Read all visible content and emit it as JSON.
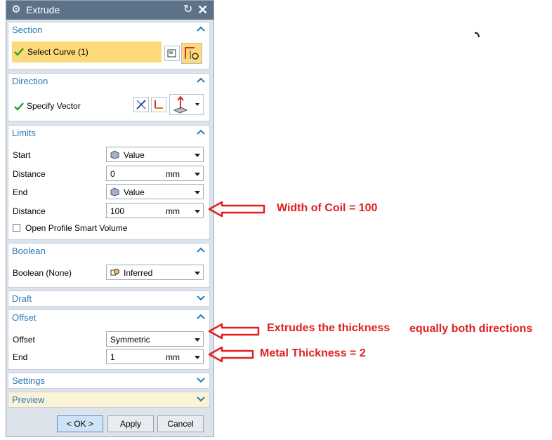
{
  "dialog": {
    "title": "Extrude",
    "reset_icon": "reset-icon",
    "close_icon": "close-icon"
  },
  "section": {
    "title": "Section",
    "select_curve_label": "Select Curve (1)"
  },
  "direction": {
    "title": "Direction",
    "specify_vector_label": "Specify Vector"
  },
  "limits": {
    "title": "Limits",
    "start_label": "Start",
    "start_value": "Value",
    "distance1_label": "Distance",
    "distance1_value": "0",
    "distance1_unit": "mm",
    "end_label": "End",
    "end_value": "Value",
    "distance2_label": "Distance",
    "distance2_value": "100",
    "distance2_unit": "mm",
    "open_profile_label": "Open Profile Smart Volume"
  },
  "boolean": {
    "title": "Boolean",
    "label": "Boolean (None)",
    "value": "Inferred"
  },
  "draft": {
    "title": "Draft"
  },
  "offset": {
    "title": "Offset",
    "offset_label": "Offset",
    "offset_value": "Symmetric",
    "end_label": "End",
    "end_value": "1",
    "end_unit": "mm"
  },
  "settings": {
    "title": "Settings"
  },
  "preview": {
    "title": "Preview"
  },
  "buttons": {
    "ok": "< OK >",
    "apply": "Apply",
    "cancel": "Cancel"
  },
  "annotations": {
    "width": "Width of Coil = 100",
    "extrudes": "Extrudes the thickness",
    "extrudes_tail": "equally both directions",
    "thickness": "Metal Thickness = 2"
  },
  "colors": {
    "accent": "#2a7ab8",
    "highlight": "#fcd979",
    "annotation": "#e02020",
    "titlebar": "#5d7187"
  }
}
